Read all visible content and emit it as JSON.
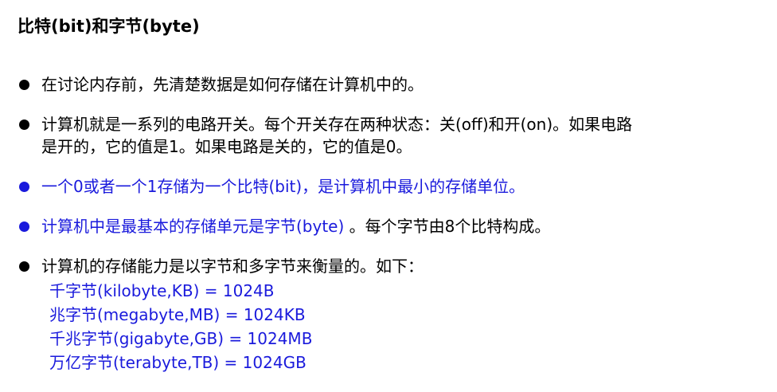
{
  "title": "比特(bit)和字节(byte)",
  "colors": {
    "text": "#000000",
    "highlight": "#1a1adc"
  },
  "bullets": [
    {
      "lines": [
        "在讨论内存前，先清楚数据是如何存储在计算机中的。"
      ],
      "highlight": false
    },
    {
      "lines": [
        "计算机就是一系列的电路开关。每个开关存在两种状态：关(off)和开(on)。如果电路",
        "是开的，它的值是1。如果电路是关的，它的值是0。"
      ],
      "highlight": false
    },
    {
      "lines": [
        "一个0或者一个1存储为一个比特(bit)，是计算机中最小的存储单位。"
      ],
      "highlight": true
    },
    {
      "lines": [
        "计算机中是最基本的存储单元是字节(byte) 。每个字节由8个比特构成。"
      ],
      "highlight": false,
      "highlight_prefix": "计算机中是最基本的存储单元是字节(byte)",
      "rest": " 。每个字节由8个比特构成。"
    },
    {
      "lines": [
        "计算机的存储能力是以字节和多字节来衡量的。如下："
      ],
      "highlight": false,
      "sub_items": [
        "千字节(kilobyte,KB)  = 1024B",
        "兆字节(megabyte,MB) = 1024KB",
        "千兆字节(gigabyte,GB) = 1024MB",
        "万亿字节(terabyte,TB) = 1024GB"
      ]
    }
  ]
}
